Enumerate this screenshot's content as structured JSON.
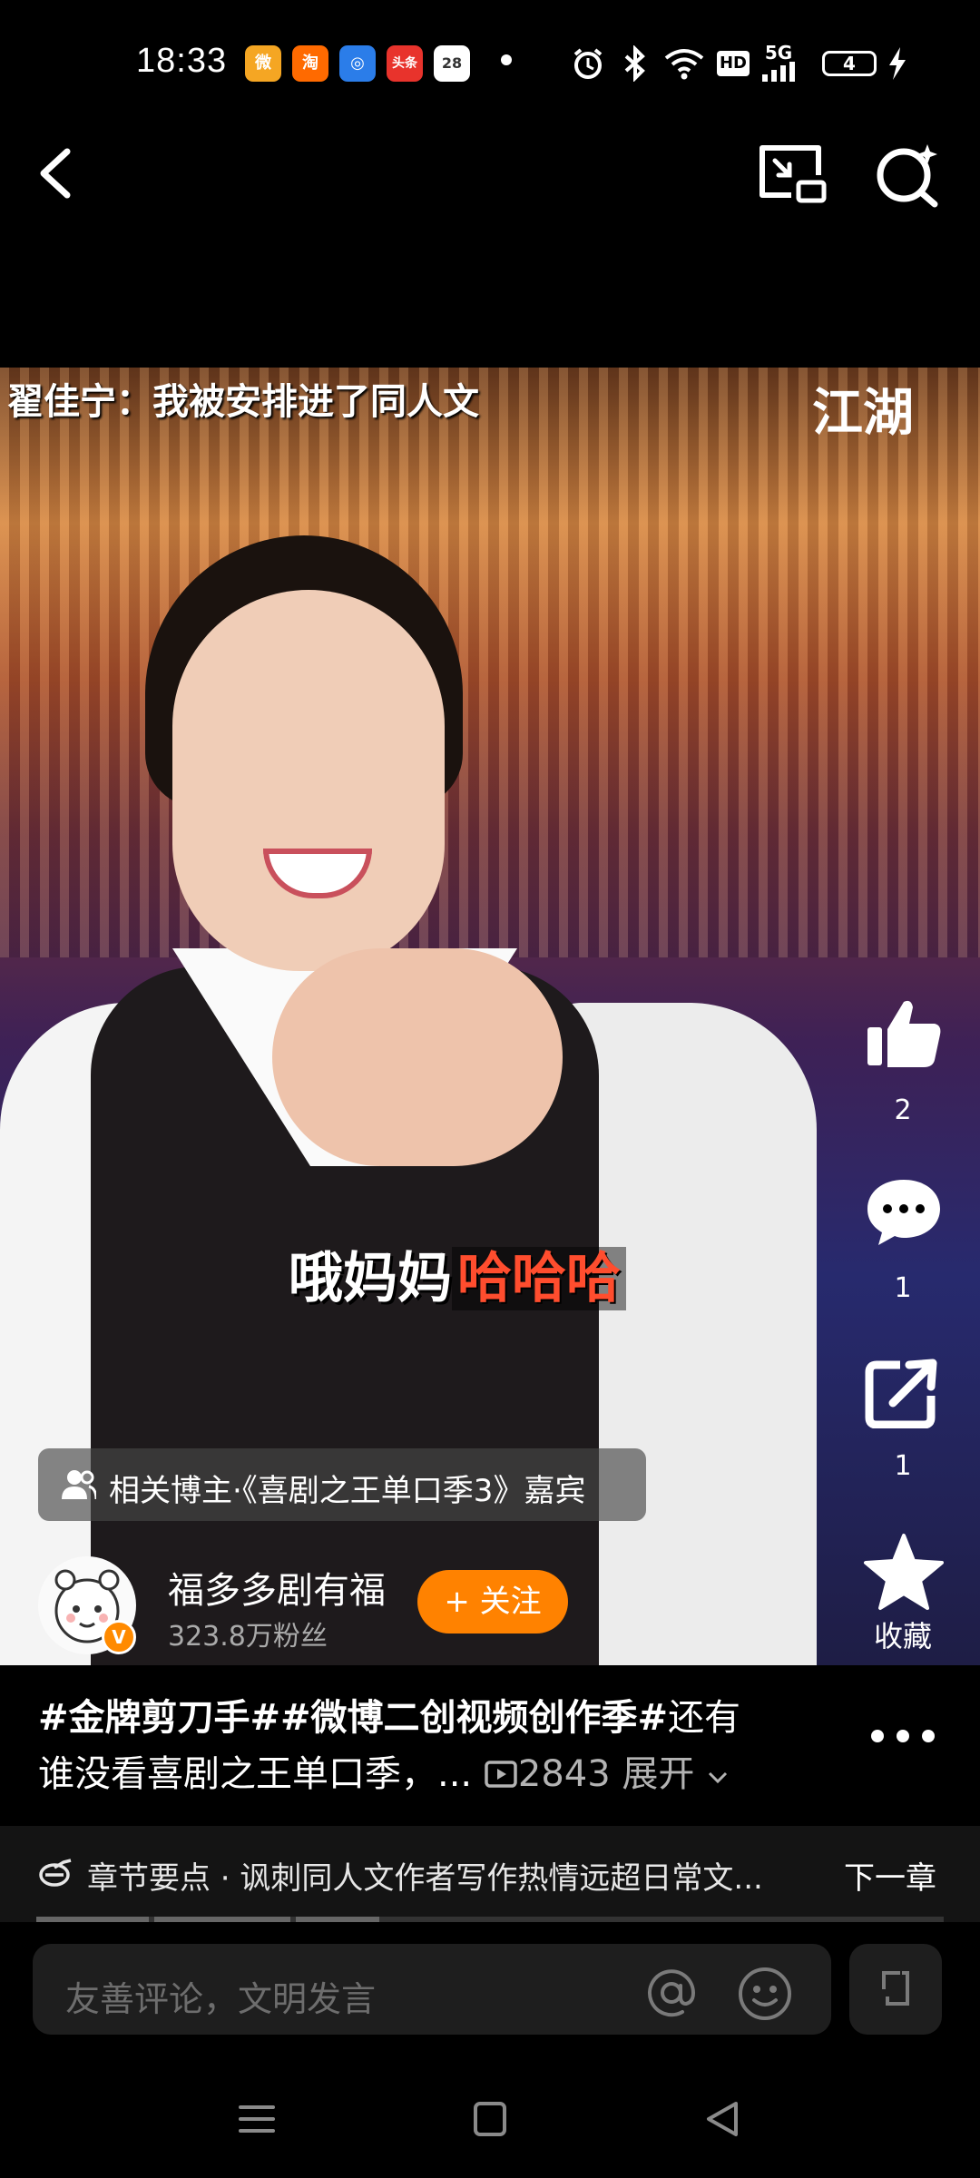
{
  "status_bar": {
    "time": "18:33",
    "apps": [
      {
        "icon": "weibo-app-icon",
        "color": "#f5a623",
        "glyph": "微"
      },
      {
        "icon": "taobao-app-icon",
        "color": "#ff6a00",
        "glyph": "淘"
      },
      {
        "icon": "browser-app-icon",
        "color": "#2b7de9",
        "glyph": "◎"
      },
      {
        "icon": "toutiao-app-icon",
        "color": "#e8332c",
        "glyph": "头条"
      },
      {
        "icon": "calendar-app-icon",
        "color": "#ffffff",
        "glyph": "28"
      }
    ],
    "network": "HD",
    "signal": "5G",
    "battery": "4"
  },
  "video": {
    "caption_top": "翟佳宁：我被安排进了同人文",
    "watermark": "江湖",
    "subtitle_white": "哦妈妈",
    "subtitle_red": "哈哈哈"
  },
  "actions": {
    "like_count": "2",
    "comment_count": "1",
    "share_count": "1",
    "favorite_label": "收藏"
  },
  "related": {
    "text": "相关博主·《喜剧之王单口季3》嘉宾"
  },
  "author": {
    "name": "福多多剧有福",
    "fans": "323.8万粉丝",
    "follow_label": "+ 关注"
  },
  "description": {
    "hashtags": "#金牌剪刀手##微博二创视频创作季#",
    "line1_rest": "还有",
    "line2_text": "谁没看喜剧之王单口季，...",
    "play_count": "2843",
    "expand_label": "展开"
  },
  "chapter": {
    "text": "章节要点 · 讽刺同人文作者写作热情远超日常文...",
    "next_label": "下一章"
  },
  "comment": {
    "placeholder": "友善评论，文明发言"
  }
}
